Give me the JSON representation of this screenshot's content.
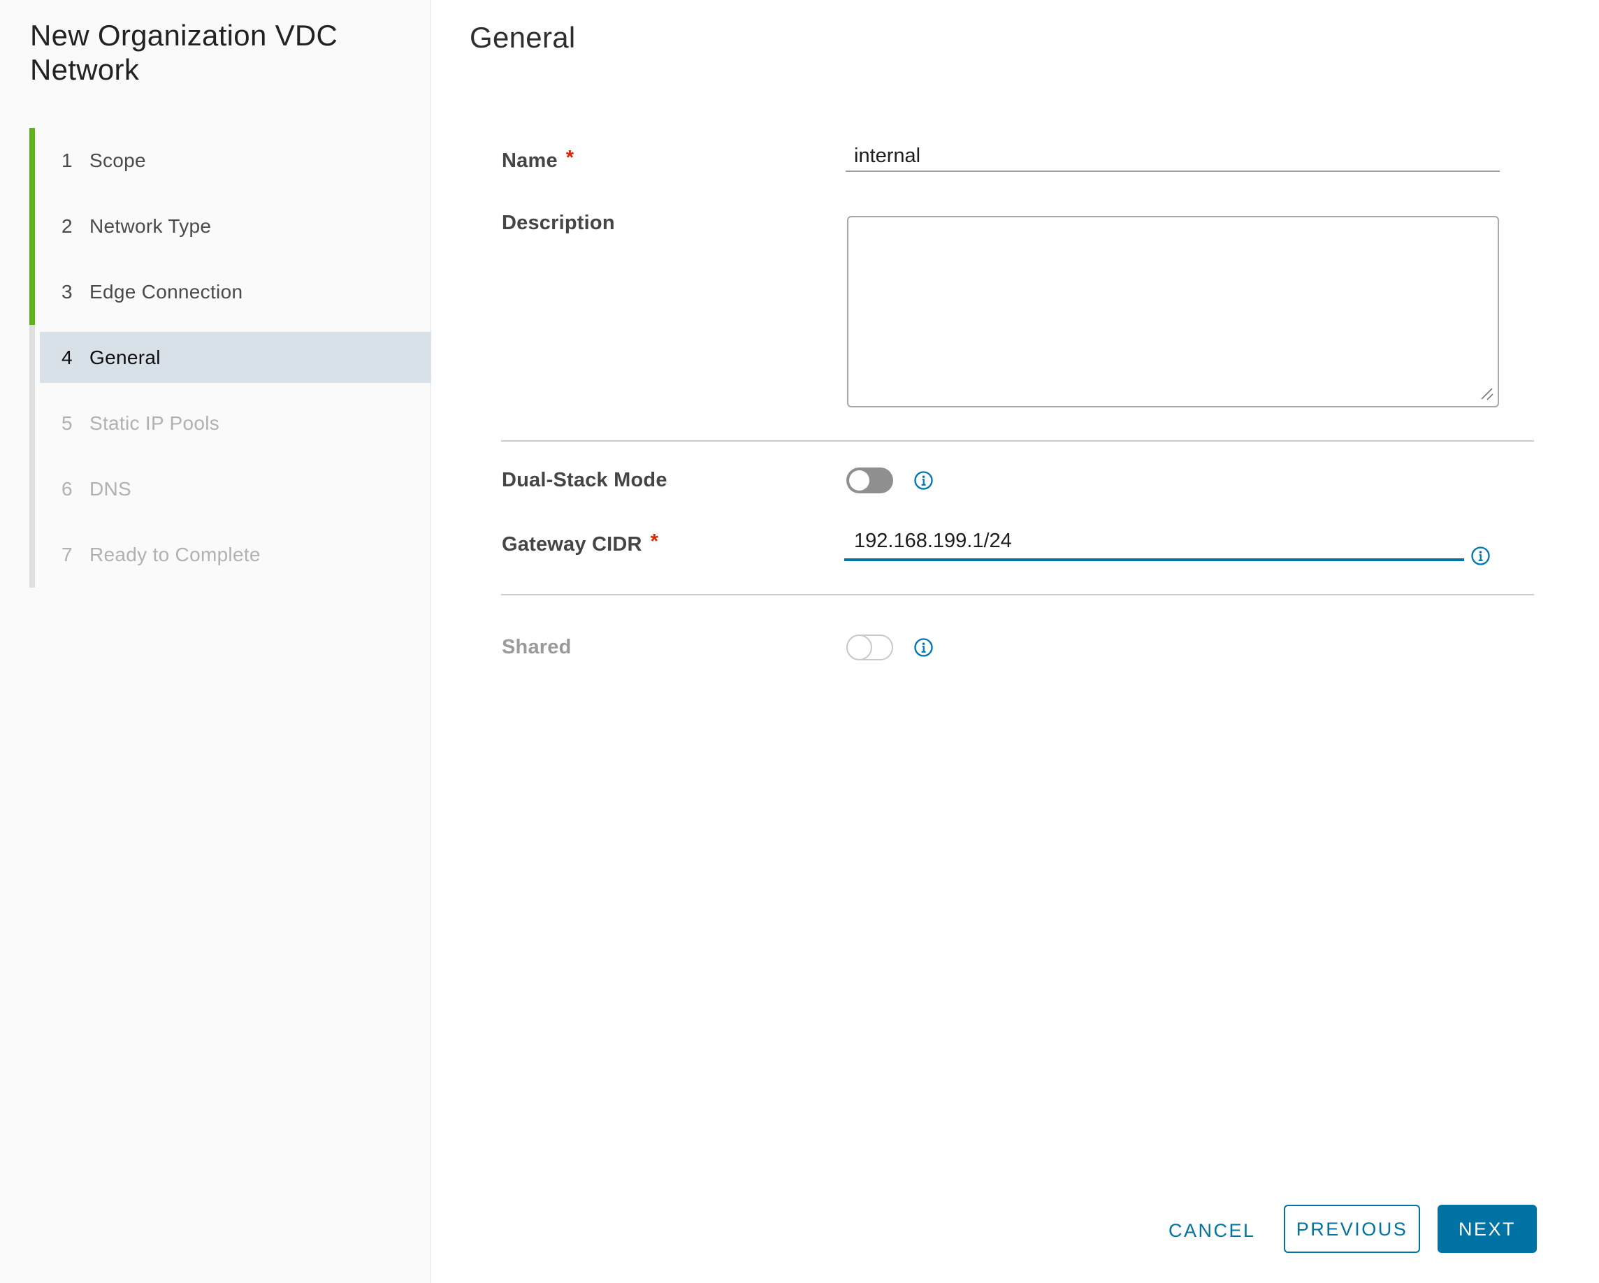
{
  "wizard": {
    "title": "New Organization VDC Network",
    "steps": [
      {
        "number": "1",
        "label": "Scope",
        "state": "completed"
      },
      {
        "number": "2",
        "label": "Network Type",
        "state": "completed"
      },
      {
        "number": "3",
        "label": "Edge Connection",
        "state": "completed"
      },
      {
        "number": "4",
        "label": "General",
        "state": "active"
      },
      {
        "number": "5",
        "label": "Static IP Pools",
        "state": "upcoming"
      },
      {
        "number": "6",
        "label": "DNS",
        "state": "upcoming"
      },
      {
        "number": "7",
        "label": "Ready to Complete",
        "state": "upcoming"
      }
    ]
  },
  "ui": {
    "required_marker": "*"
  },
  "page": {
    "heading": "General",
    "fields": {
      "name": {
        "label": "Name",
        "required": true,
        "value": "internal"
      },
      "description": {
        "label": "Description",
        "value": ""
      },
      "dual_stack": {
        "label": "Dual-Stack Mode",
        "state": "off"
      },
      "gateway_cidr": {
        "label": "Gateway CIDR",
        "required": true,
        "value": "192.168.199.1/24"
      },
      "shared": {
        "label": "Shared",
        "state": "off",
        "disabled": true
      }
    }
  },
  "footer": {
    "cancel_label": "CANCEL",
    "previous_label": "PREVIOUS",
    "next_label": "NEXT"
  },
  "colors": {
    "accent_blue": "#0072a3",
    "info_blue": "#0077b4",
    "step_green": "#5eb219",
    "active_step_bg": "#d8e0e8",
    "toggle_off_gray": "#8f8f8f"
  }
}
